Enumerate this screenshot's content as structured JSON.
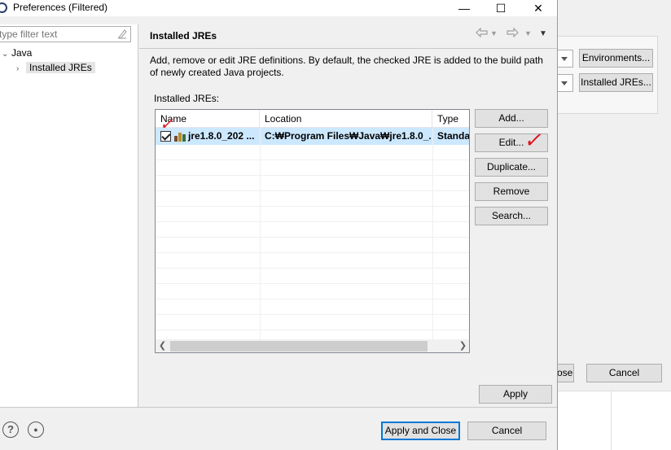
{
  "window": {
    "title": "Preferences (Filtered)",
    "minimize_glyph": "—",
    "maximize_glyph": "☐",
    "close_glyph": "✕"
  },
  "filter": {
    "placeholder": "type filter text"
  },
  "tree": {
    "root": "Java",
    "child": "Installed JREs"
  },
  "page": {
    "title": "Installed JREs",
    "description": "Add, remove or edit JRE definitions. By default, the checked JRE is added to the build path of newly created Java projects.",
    "list_label": "Installed JREs:"
  },
  "table": {
    "columns": [
      "Name",
      "Location",
      "Type"
    ],
    "rows": [
      {
        "checked": true,
        "name": "jre1.8.0_202 ...",
        "location": "C:₩Program Files₩Java₩jre1.8.0_...",
        "type": "Standa"
      }
    ]
  },
  "buttons": {
    "add": "Add...",
    "edit": "Edit...",
    "duplicate": "Duplicate...",
    "remove": "Remove",
    "search": "Search...",
    "apply": "Apply",
    "apply_close": "Apply and Close",
    "cancel": "Cancel"
  },
  "background_window": {
    "environments": "Environments...",
    "installed_jres": "Installed JREs...",
    "close_partial": "ose",
    "cancel": "Cancel"
  },
  "annotations": {
    "check_mark": "✓"
  },
  "colors": {
    "selection": "#cce8ff",
    "default_button_border": "#0078d7",
    "annotation_red": "#e0141e"
  },
  "icons": [
    "app-icon",
    "clear-icon",
    "back-icon",
    "forward-icon",
    "view-menu-icon",
    "help-icon",
    "import-export-icon",
    "jre-library-icon"
  ]
}
